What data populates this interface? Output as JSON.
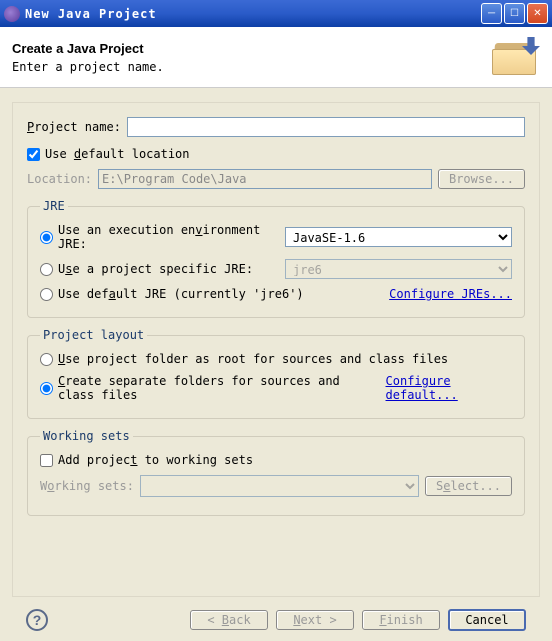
{
  "window": {
    "title": "New Java Project"
  },
  "header": {
    "title": "Create a Java Project",
    "subtitle": "Enter a project name."
  },
  "projectName": {
    "label": "Project name:",
    "value": ""
  },
  "defaultLocation": {
    "label": "Use default location",
    "checked": true
  },
  "location": {
    "label": "Location:",
    "value": "E:\\Program Code\\Java",
    "browse": "Browse..."
  },
  "jre": {
    "legend": "JRE",
    "opt1": "Use an execution environment JRE:",
    "opt1Select": "JavaSE-1.6",
    "opt2": "Use a project specific JRE:",
    "opt2Select": "jre6",
    "opt3": "Use default JRE (currently 'jre6')",
    "configure": "Configure JREs..."
  },
  "layout": {
    "legend": "Project layout",
    "opt1": "Use project folder as root for sources and class files",
    "opt2": "Create separate folders for sources and class files",
    "configure": "Configure default..."
  },
  "workingSets": {
    "legend": "Working sets",
    "add": "Add project to working sets",
    "label": "Working sets:",
    "select": "Select..."
  },
  "buttons": {
    "back": "< Back",
    "next": "Next >",
    "finish": "Finish",
    "cancel": "Cancel"
  }
}
